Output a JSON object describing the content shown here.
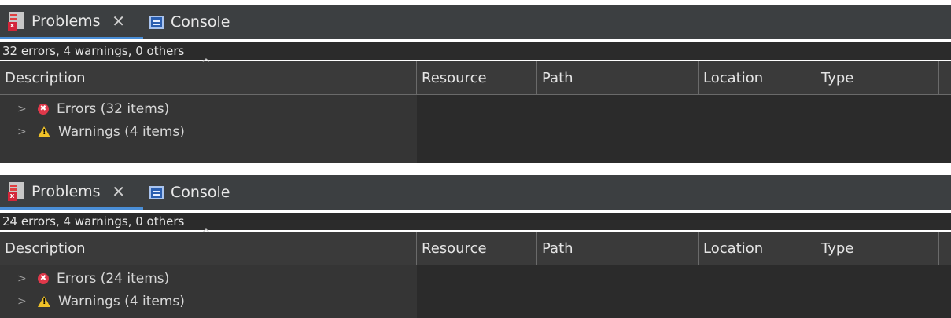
{
  "panels": [
    {
      "tabs": {
        "problems_label": "Problems",
        "console_label": "Console"
      },
      "summary": "32 errors, 4 warnings, 0 others",
      "columns": [
        "Description",
        "Resource",
        "Path",
        "Location",
        "Type"
      ],
      "rows": [
        {
          "label": "Errors (32 items)",
          "icon": "error-icon"
        },
        {
          "label": "Warnings (4 items)",
          "icon": "warning-icon"
        }
      ]
    },
    {
      "tabs": {
        "problems_label": "Problems",
        "console_label": "Console"
      },
      "summary": "24 errors, 4 warnings, 0 others",
      "columns": [
        "Description",
        "Resource",
        "Path",
        "Location",
        "Type"
      ],
      "rows": [
        {
          "label": "Errors (24 items)",
          "icon": "error-icon"
        },
        {
          "label": "Warnings (4 items)",
          "icon": "warning-icon"
        }
      ]
    }
  ],
  "colors": {
    "tabbar_bg": "#3c3f41",
    "content_bg": "#2b2b2b",
    "active_tab_underline": "#4a8fd8",
    "error": "#e0384a",
    "warning": "#f0c228"
  }
}
